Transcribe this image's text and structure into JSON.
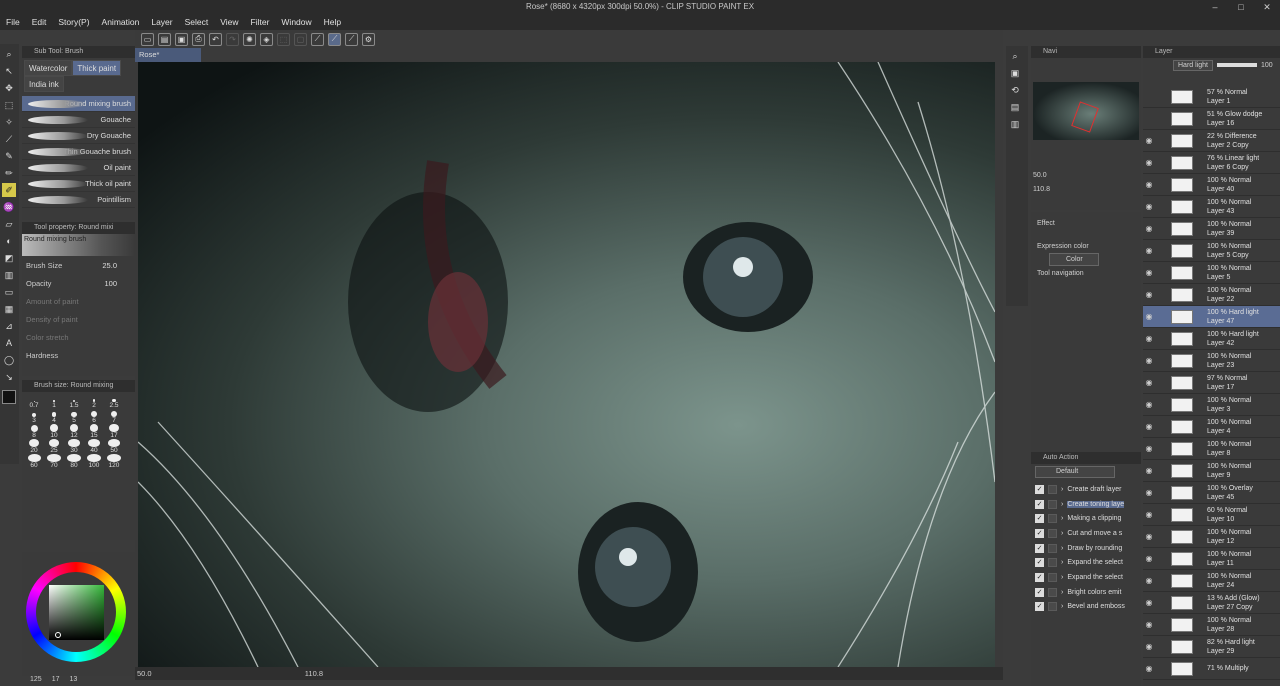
{
  "window": {
    "title": "Rose* (8680 x 4320px 300dpi 50.0%) - CLIP STUDIO PAINT EX"
  },
  "menu": [
    "File",
    "Edit",
    "Story(P)",
    "Animation",
    "Layer",
    "Select",
    "View",
    "Filter",
    "Window",
    "Help"
  ],
  "subtool": {
    "header": "Sub Tool: Brush",
    "tabs": [
      "Watercolor",
      "Thick paint",
      "India ink"
    ],
    "brushes": [
      "Round mixing brush",
      "Gouache",
      "Dry Gouache",
      "Thin Gouache brush",
      "Oil paint",
      "Thick oil paint",
      "Pointillism"
    ]
  },
  "toolprop": {
    "header": "Tool property: Round mixi",
    "preset": "Round mixing brush",
    "rows": [
      {
        "label": "Brush Size",
        "value": "25.0"
      },
      {
        "label": "Opacity",
        "value": "100"
      },
      {
        "label": "Amount of paint",
        "value": ""
      },
      {
        "label": "Density of paint",
        "value": ""
      },
      {
        "label": "Color stretch",
        "value": ""
      },
      {
        "label": "Hardness",
        "value": ""
      }
    ]
  },
  "brushsize": {
    "header": "Brush size: Round mixing",
    "sizes": [
      "0.7",
      "1",
      "1.5",
      "2",
      "2.5",
      "3",
      "4",
      "5",
      "6",
      "7",
      "8",
      "10",
      "12",
      "15",
      "17",
      "20",
      "25",
      "30",
      "40",
      "50",
      "60",
      "70",
      "80",
      "100",
      "120"
    ]
  },
  "document": {
    "tab": "Rose*"
  },
  "status": {
    "zoom": "50.0",
    "angle": "110.8",
    "bottom_left": "125",
    "bottom_mid": "17",
    "bottom_right": "13"
  },
  "navigator": {
    "tab": "Navi",
    "zoom": "50.0",
    "angle": "110.8"
  },
  "subview": {
    "effect": "Effect",
    "expression_color": "Expression color",
    "color_mode": "Color",
    "tool_navigation": "Tool navigation"
  },
  "autoaction": {
    "tab": "Auto Action",
    "set": "Default",
    "items": [
      "Create draft layer",
      "Create toning laye",
      "Making a clipping",
      "Cut and move a s",
      "Draw by rounding",
      "Expand the select",
      "Expand the select",
      "Bright colors emit",
      "Bevel and emboss"
    ]
  },
  "layer_panel": {
    "tab": "Layer",
    "blend_mode": "Hard light",
    "opacity": "100",
    "layers": [
      {
        "pct": "57 %",
        "mode": "Normal",
        "name": "Layer 1",
        "visible": false
      },
      {
        "pct": "51 %",
        "mode": "Glow dodge",
        "name": "Layer 16",
        "visible": false
      },
      {
        "pct": "22 %",
        "mode": "Difference",
        "name": "Layer 2 Copy",
        "visible": true
      },
      {
        "pct": "76 %",
        "mode": "Linear light",
        "name": "Layer 6 Copy",
        "visible": true
      },
      {
        "pct": "100 %",
        "mode": "Normal",
        "name": "Layer 40",
        "visible": true
      },
      {
        "pct": "100 %",
        "mode": "Normal",
        "name": "Layer 43",
        "visible": true
      },
      {
        "pct": "100 %",
        "mode": "Normal",
        "name": "Layer 39",
        "visible": true
      },
      {
        "pct": "100 %",
        "mode": "Normal",
        "name": "Layer 5 Copy",
        "visible": true
      },
      {
        "pct": "100 %",
        "mode": "Normal",
        "name": "Layer 5",
        "visible": true
      },
      {
        "pct": "100 %",
        "mode": "Normal",
        "name": "Layer 22",
        "visible": true
      },
      {
        "pct": "100 %",
        "mode": "Hard light",
        "name": "Layer 47",
        "visible": true,
        "selected": true
      },
      {
        "pct": "100 %",
        "mode": "Hard light",
        "name": "Layer 42",
        "visible": true
      },
      {
        "pct": "100 %",
        "mode": "Normal",
        "name": "Layer 23",
        "visible": true
      },
      {
        "pct": "97 %",
        "mode": "Normal",
        "name": "Layer 17",
        "visible": true
      },
      {
        "pct": "100 %",
        "mode": "Normal",
        "name": "Layer 3",
        "visible": true
      },
      {
        "pct": "100 %",
        "mode": "Normal",
        "name": "Layer 4",
        "visible": true
      },
      {
        "pct": "100 %",
        "mode": "Normal",
        "name": "Layer 8",
        "visible": true
      },
      {
        "pct": "100 %",
        "mode": "Normal",
        "name": "Layer 9",
        "visible": true
      },
      {
        "pct": "100 %",
        "mode": "Overlay",
        "name": "Layer 45",
        "visible": true
      },
      {
        "pct": "60 %",
        "mode": "Normal",
        "name": "Layer 10",
        "visible": true
      },
      {
        "pct": "100 %",
        "mode": "Normal",
        "name": "Layer 12",
        "visible": true
      },
      {
        "pct": "100 %",
        "mode": "Normal",
        "name": "Layer 11",
        "visible": true
      },
      {
        "pct": "100 %",
        "mode": "Normal",
        "name": "Layer 24",
        "visible": true
      },
      {
        "pct": "13 %",
        "mode": "Add (Glow)",
        "name": "Layer 27 Copy",
        "visible": true
      },
      {
        "pct": "100 %",
        "mode": "Normal",
        "name": "Layer 28",
        "visible": true
      },
      {
        "pct": "82 %",
        "mode": "Hard light",
        "name": "Layer 29",
        "visible": true
      },
      {
        "pct": "71 %",
        "mode": "Multiply",
        "name": "",
        "visible": true
      }
    ]
  },
  "colors": {
    "accent": "#596a8f",
    "active_tool": "#d6c84a",
    "wheel_green": "#35b83a"
  }
}
